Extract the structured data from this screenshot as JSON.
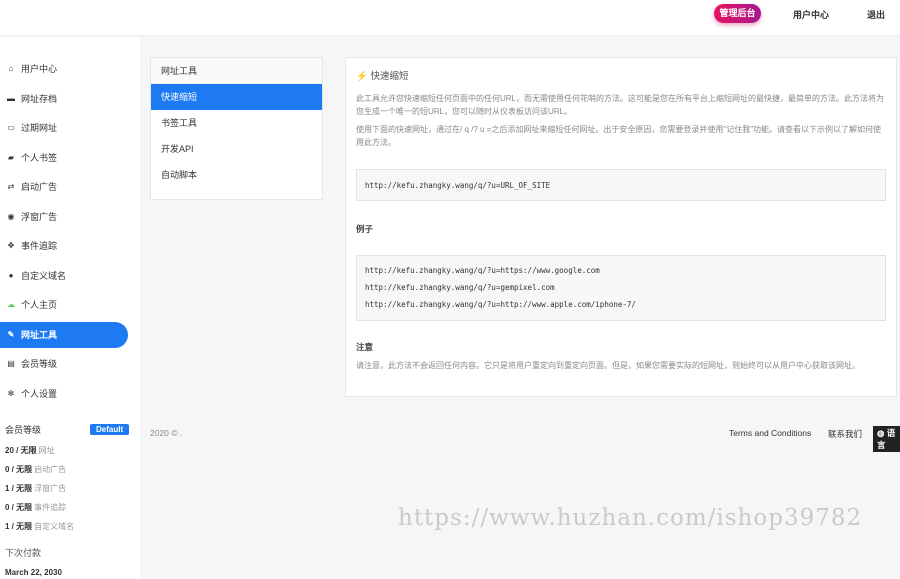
{
  "header": {
    "admin": "管理后台",
    "user_center": "用户中心",
    "logout": "退出"
  },
  "sidebar": {
    "items": [
      {
        "icon": "home-icon",
        "glyph": "⌂",
        "label": "用户中心"
      },
      {
        "icon": "briefcase-icon",
        "glyph": "▬",
        "label": "网址存档"
      },
      {
        "icon": "calendar-icon",
        "glyph": "▭",
        "label": "过期网址"
      },
      {
        "icon": "folder-icon",
        "glyph": "▰",
        "label": "个人书签"
      },
      {
        "icon": "exchange-icon",
        "glyph": "⇄",
        "label": "启动广告"
      },
      {
        "icon": "target-icon",
        "glyph": "◉",
        "label": "浮窗广告"
      },
      {
        "icon": "crosshair-icon",
        "glyph": "✥",
        "label": "事件追踪"
      },
      {
        "icon": "globe-icon",
        "glyph": "●",
        "label": "自定义域名"
      },
      {
        "icon": "cloud-icon",
        "glyph": "☁",
        "label": "个人主页"
      },
      {
        "icon": "wrench-icon",
        "glyph": "✎",
        "label": "网址工具"
      },
      {
        "icon": "card-icon",
        "glyph": "▤",
        "label": "会员等级"
      },
      {
        "icon": "gear-icon",
        "glyph": "✻",
        "label": "个人设置"
      }
    ],
    "membership": {
      "title": "会员等级",
      "badge": "Default",
      "stats": [
        {
          "value": "20 / 无限",
          "label": "网址"
        },
        {
          "value": "0 / 无限",
          "label": "启动广告"
        },
        {
          "value": "1 / 无限",
          "label": "浮窗广告"
        },
        {
          "value": "0 / 无限",
          "label": "事件追踪"
        },
        {
          "value": "1 / 无限",
          "label": "自定义域名"
        }
      ],
      "next_payment_label": "下次付款",
      "next_payment": "March 22, 2030"
    }
  },
  "submenu": {
    "title": "网址工具",
    "items": [
      "快速缩短",
      "书签工具",
      "开发API",
      "自动脚本"
    ]
  },
  "content": {
    "title": "快速缩短",
    "p1": "此工具允许您快速缩短任何页面中的任何URL，而无需使用任何花哨的方法。这可能是您在所有平台上缩短网址的最快捷，最简单的方法。此方法将为您生成一个唯一的短URL，您可以随时从仪表板访问该URL。",
    "p2": "使用下面的快速网址，通过在/ q /? u =之后添加网址来缩短任何网址。出于安全原因，您需要登录并使用\"记住我\"功能。请查看以下示例以了解如何使用此方法。",
    "code1": "http://kefu.zhangky.wang/q/?u=URL_OF_SITE",
    "example_title": "例子",
    "examples": [
      "http://kefu.zhangky.wang/q/?u=https://www.google.com",
      "http://kefu.zhangky.wang/q/?u=gempixel.com",
      "http://kefu.zhangky.wang/q/?u=http://www.apple.com/iphone-7/"
    ],
    "note_title": "注意",
    "note": "请注意，此方法不会返回任何内容。它只是将用户重定向到重定向页面。但是，如果您需要实际的短网址，则始终可以从用户中心获取该网址。"
  },
  "footer": {
    "copyright": "2020 © .",
    "terms": "Terms and Conditions",
    "contact": "联系我们",
    "language": "语言"
  },
  "watermark": "https://www.huzhan.com/ishop39782"
}
